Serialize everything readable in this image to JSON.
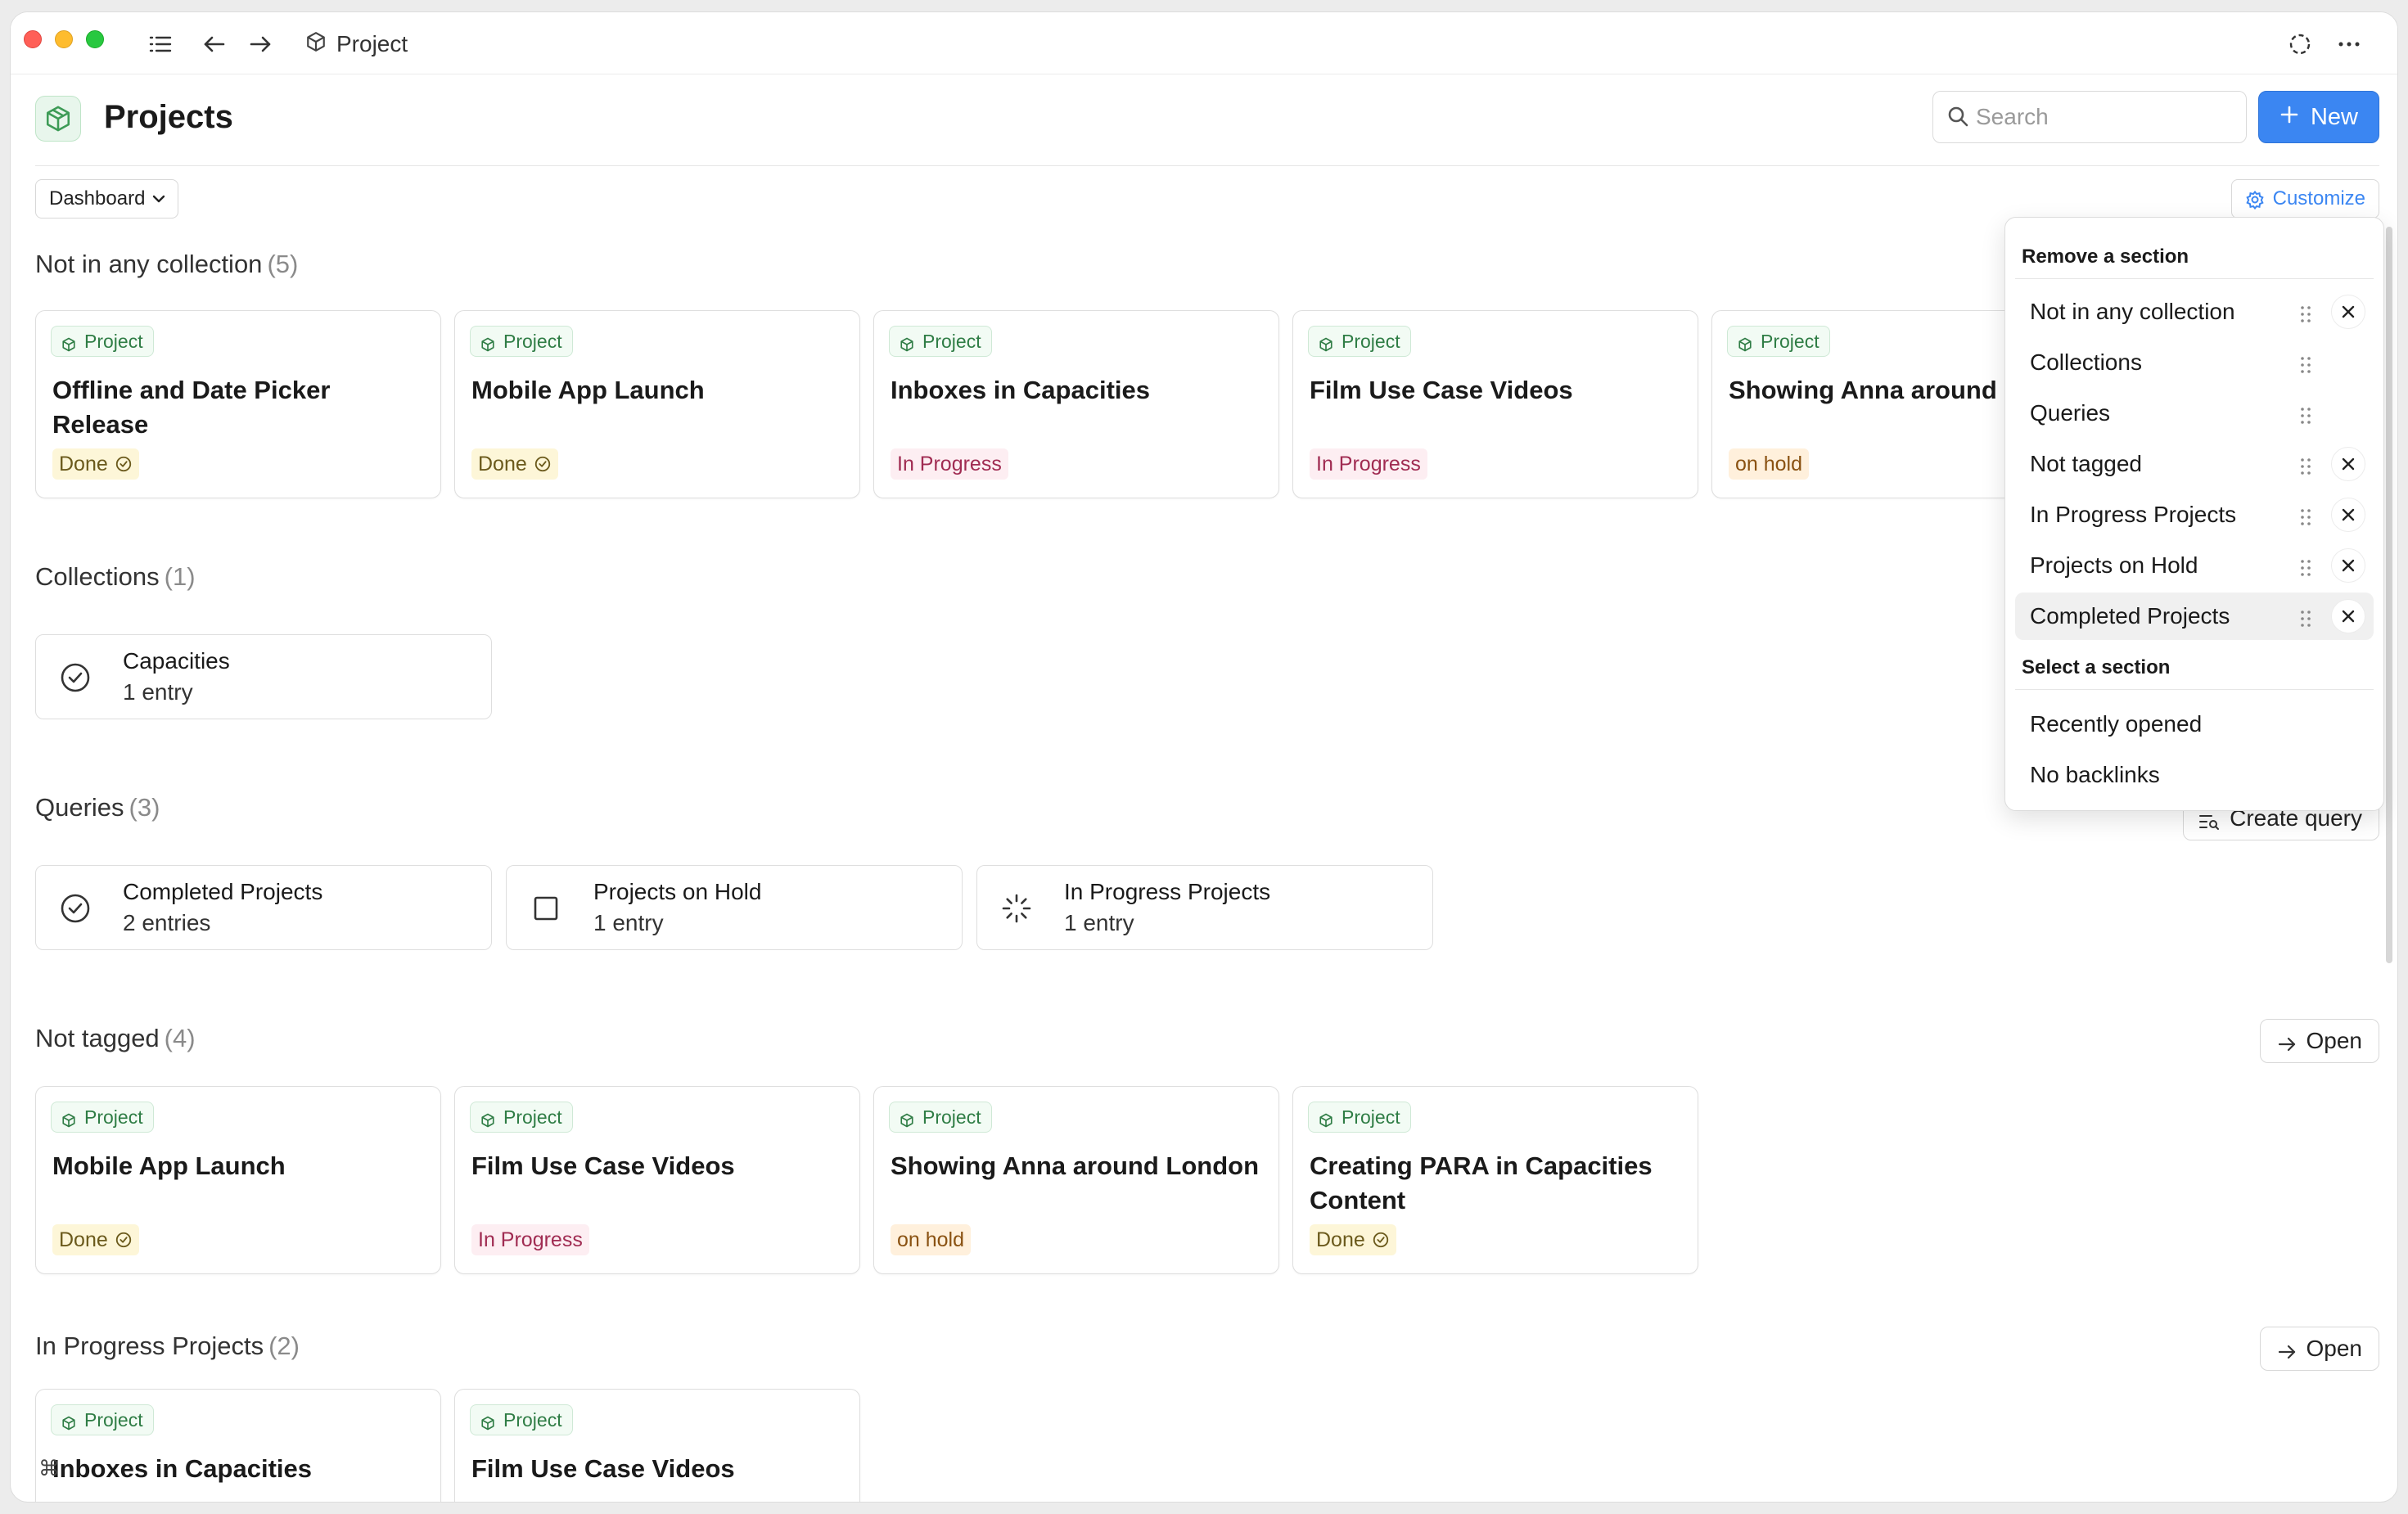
{
  "titlebar": {
    "breadcrumb": "Project"
  },
  "header": {
    "title": "Projects",
    "search_placeholder": "Search",
    "new_label": "New"
  },
  "toolbar": {
    "view_label": "Dashboard",
    "customize_label": "Customize"
  },
  "sections": {
    "not_in_collection": {
      "title": "Not in any collection",
      "count": "(5)",
      "cards": [
        {
          "tag": "Project",
          "title": "Offline and Date Picker Release",
          "status": "Done",
          "status_type": "done"
        },
        {
          "tag": "Project",
          "title": "Mobile App Launch",
          "status": "Done",
          "status_type": "done"
        },
        {
          "tag": "Project",
          "title": "Inboxes in Capacities",
          "status": "In Progress",
          "status_type": "progress"
        },
        {
          "tag": "Project",
          "title": "Film Use Case Videos",
          "status": "In Progress",
          "status_type": "progress"
        },
        {
          "tag": "Project",
          "title": "Showing Anna around London",
          "status": "on hold",
          "status_type": "hold"
        }
      ]
    },
    "collections": {
      "title": "Collections",
      "count": "(1)",
      "items": [
        {
          "name": "Capacities",
          "sub": "1 entry",
          "icon": "check-circle-icon"
        }
      ]
    },
    "queries": {
      "title": "Queries",
      "count": "(3)",
      "action_label": "Create query",
      "items": [
        {
          "name": "Completed Projects",
          "sub": "2 entries",
          "icon": "check-circle-icon"
        },
        {
          "name": "Projects on Hold",
          "sub": "1 entry",
          "icon": "square-icon"
        },
        {
          "name": "In Progress Projects",
          "sub": "1 entry",
          "icon": "loader-icon"
        }
      ]
    },
    "not_tagged": {
      "title": "Not tagged",
      "count": "(4)",
      "action_label": "Open",
      "cards": [
        {
          "tag": "Project",
          "title": "Mobile App Launch",
          "status": "Done",
          "status_type": "done"
        },
        {
          "tag": "Project",
          "title": "Film Use Case Videos",
          "status": "In Progress",
          "status_type": "progress"
        },
        {
          "tag": "Project",
          "title": "Showing Anna around London",
          "status": "on hold",
          "status_type": "hold"
        },
        {
          "tag": "Project",
          "title": "Creating PARA in Capacities Content",
          "status": "Done",
          "status_type": "done"
        }
      ]
    },
    "in_progress": {
      "title": "In Progress Projects",
      "count": "(2)",
      "action_label": "Open",
      "cards": [
        {
          "tag": "Project",
          "title": "Inboxes in Capacities"
        },
        {
          "tag": "Project",
          "title": "Film Use Case Videos"
        }
      ]
    }
  },
  "dropdown": {
    "remove_header": "Remove a section",
    "remove_items": [
      {
        "label": "Not in any collection",
        "removable": true
      },
      {
        "label": "Collections",
        "removable": false
      },
      {
        "label": "Queries",
        "removable": false
      },
      {
        "label": "Not tagged",
        "removable": true
      },
      {
        "label": "In Progress Projects",
        "removable": true
      },
      {
        "label": "Projects on Hold",
        "removable": true
      },
      {
        "label": "Completed Projects",
        "removable": true
      }
    ],
    "select_header": "Select a section",
    "select_items": [
      {
        "label": "Recently opened"
      },
      {
        "label": "No backlinks"
      }
    ]
  },
  "colors": {
    "accent": "#3b86f2",
    "tag_green": "#2f7d45",
    "done_bg": "#fdf6d8",
    "progress_bg": "#fdeef2",
    "hold_bg": "#fff0dc"
  }
}
